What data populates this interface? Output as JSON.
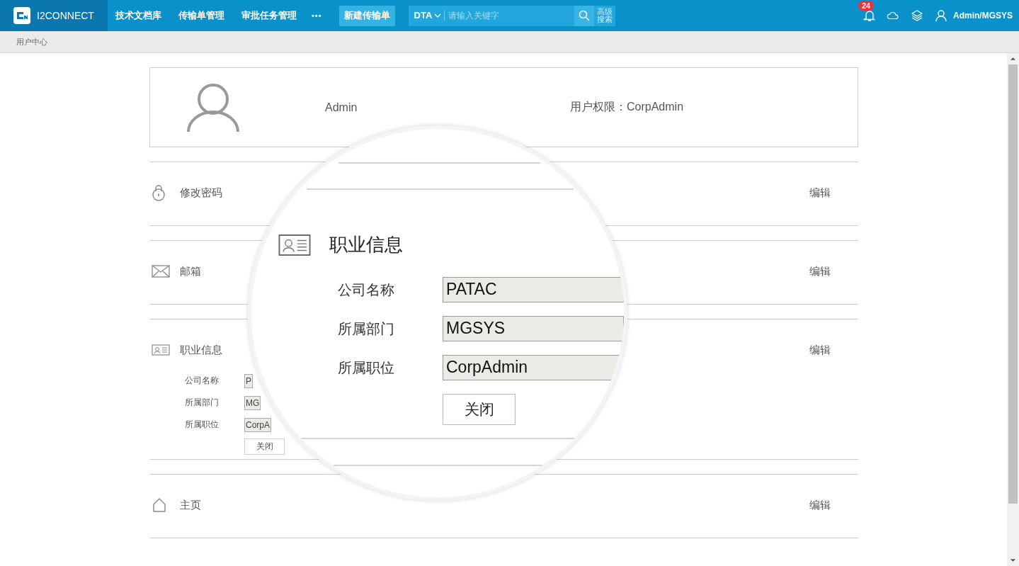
{
  "top_bar": {
    "logo": "I2CONNECT",
    "nav": [
      {
        "label": "技术文档库"
      },
      {
        "label": "传输单管理"
      },
      {
        "label": "审批任务管理"
      }
    ],
    "more": "•••",
    "new_button": "新建传输单",
    "search": {
      "scope": "DTA",
      "placeholder": "请输入关键字",
      "advanced": "高级搜索"
    },
    "notifications": {
      "count": "24"
    },
    "user": "Admin/MGSYS"
  },
  "breadcrumb": "用户中心",
  "profile": {
    "name": "Admin",
    "permission": "用户权限：CorpAdmin"
  },
  "sections": [
    {
      "kind": "password",
      "title": "修改密码",
      "action": "编辑",
      "expanded": false
    },
    {
      "kind": "mail",
      "title": "邮箱",
      "action": "编辑",
      "expanded": false
    },
    {
      "kind": "job",
      "title": "职业信息",
      "action": "编辑",
      "expanded": true,
      "fields": [
        {
          "label": "公司名称",
          "value": "P"
        },
        {
          "label": "所属部门",
          "value": "MG"
        },
        {
          "label": "所属职位",
          "value": "CorpA"
        }
      ],
      "close": "关闭"
    },
    {
      "kind": "home",
      "title": "主页",
      "action": "编辑",
      "expanded": false
    }
  ],
  "magnifier": {
    "title": "职业信息",
    "fields": [
      {
        "label": "公司名称",
        "value": "PATAC"
      },
      {
        "label": "所属部门",
        "value": "MGSYS"
      },
      {
        "label": "所属职位",
        "value": "CorpAdmin"
      }
    ],
    "close": "关闭"
  }
}
